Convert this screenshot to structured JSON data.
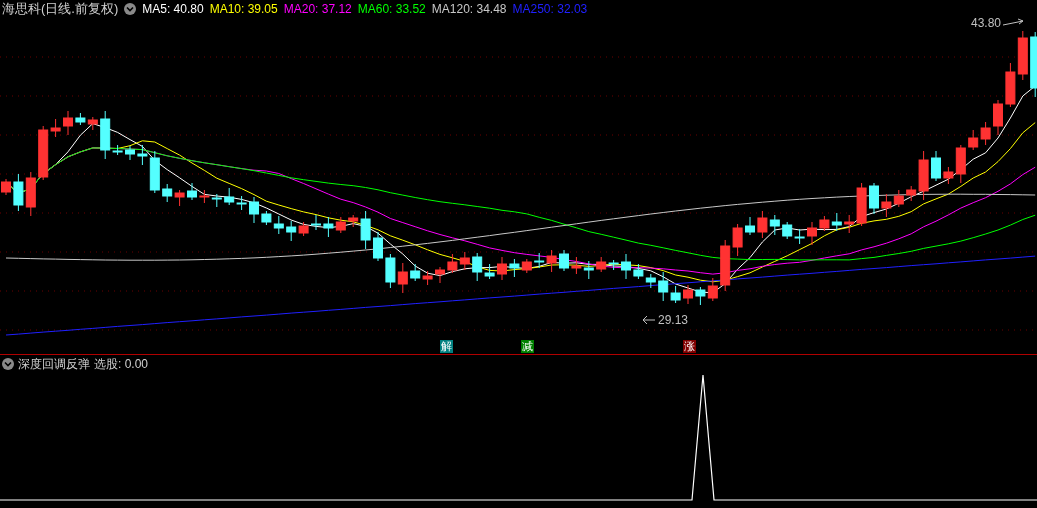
{
  "main_panel": {
    "title": "海思科(日线.前复权)",
    "indicators": [
      {
        "label": "MA5: 40.80",
        "color": "#ffffff"
      },
      {
        "label": "MA10: 39.05",
        "color": "#ffff00"
      },
      {
        "label": "MA20: 37.12",
        "color": "#ff00ff"
      },
      {
        "label": "MA60: 33.52",
        "color": "#00ff00"
      },
      {
        "label": "MA120: 34.48",
        "color": "#c8c8c8"
      },
      {
        "label": "MA250: 32.03",
        "color": "#2020ff"
      }
    ],
    "high_label": "43.80",
    "low_label": "29.13",
    "signals": [
      {
        "label": "解",
        "color": "#008080"
      },
      {
        "label": "减",
        "color": "#008000"
      },
      {
        "label": "涨",
        "color": "#800000"
      }
    ]
  },
  "sub_panel": {
    "title": "深度回调反弹",
    "reading": "选股: 0.00"
  }
}
